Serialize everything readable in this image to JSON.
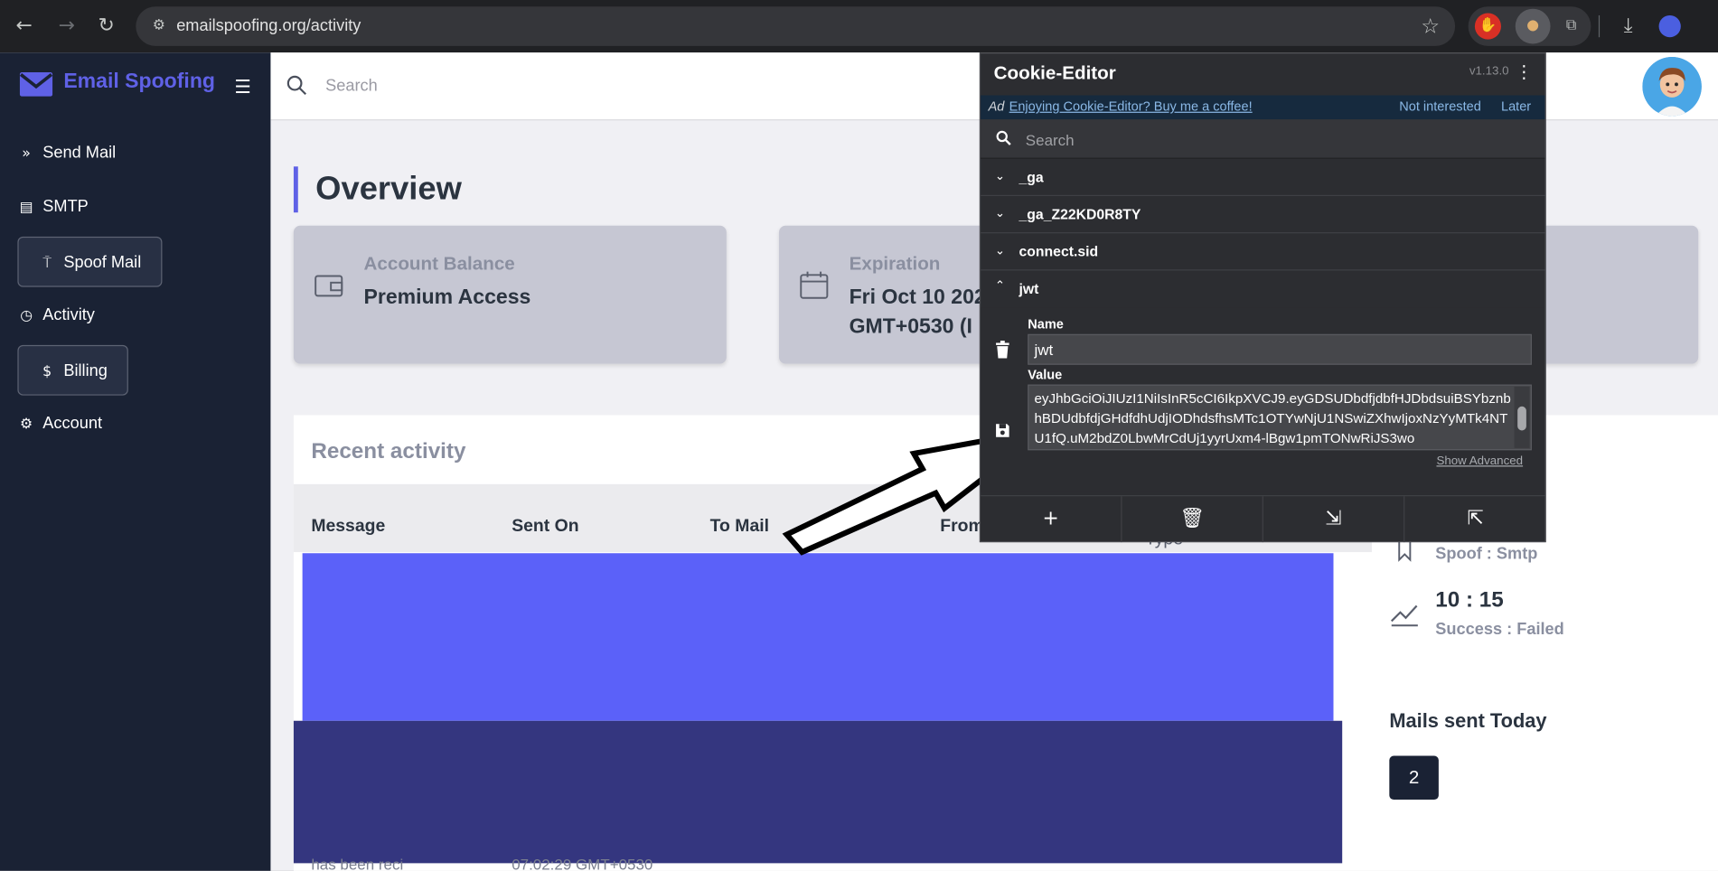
{
  "browser": {
    "url": "emailspoofing.org/activity",
    "colors": {
      "bar": "#202124",
      "omnibox": "#35363a"
    }
  },
  "app": {
    "brand": "Email Spoofing",
    "accent": "#5f61e6",
    "sidebar": {
      "items": [
        {
          "label": "Send Mail",
          "icon": "send-icon",
          "boxed": false
        },
        {
          "label": "SMTP",
          "icon": "server-icon",
          "boxed": false
        },
        {
          "label": "Spoof Mail",
          "icon": "paint-roller-icon",
          "boxed": true
        },
        {
          "label": "Activity",
          "icon": "clock-icon",
          "boxed": false
        },
        {
          "label": "Billing",
          "icon": "dollar-icon",
          "boxed": true
        },
        {
          "label": "Account",
          "icon": "gear-icon",
          "boxed": false
        }
      ]
    },
    "topbar": {
      "search_placeholder": "Search"
    },
    "page_title": "Overview",
    "cards": [
      {
        "label": "Account Balance",
        "value_line1": "Premium Access",
        "value_line2": "",
        "icon": "wallet-icon"
      },
      {
        "label": "Expiration",
        "value_line1": "Fri Oct 10 202",
        "value_line2": "GMT+0530 (I",
        "icon": "calendar-icon"
      }
    ],
    "recent_activity": {
      "title": "Recent activity",
      "columns": [
        "Message",
        "Sent On",
        "To Mail",
        "From",
        "Type"
      ],
      "partial_row": {
        "message": "has been reci",
        "sent_on": "07:02:29 GMT+0530"
      }
    },
    "stats": {
      "spoof_line": "Spoof : Smtp",
      "ratio": "10 : 15",
      "ratio_label": "Success : Failed"
    },
    "mails_today": {
      "title": "Mails sent Today",
      "count": "2"
    }
  },
  "cookie_editor": {
    "title": "Cookie-Editor",
    "version": "v1.13.0",
    "ad": {
      "tag": "Ad",
      "link": "Enjoying Cookie-Editor? Buy me a coffee!",
      "not_interested": "Not interested",
      "later": "Later"
    },
    "search_placeholder": "Search",
    "cookies": [
      {
        "name": "_ga",
        "expanded": false
      },
      {
        "name": "_ga_Z22KD0R8TY",
        "expanded": false
      },
      {
        "name": "connect.sid",
        "expanded": false
      },
      {
        "name": "jwt",
        "expanded": true
      }
    ],
    "selected": {
      "name_label": "Name",
      "name_value": "jwt",
      "value_label": "Value",
      "value": "eyJhbGciOiJIUzI1NiIsInR5cCI6IkpXVCJ9.eyGDSUDbdfjdbfHJDbdsuiBSYbznbhBDUdbfdjGHdfdhUdjIODhdsfhsMTc1OTYwNjU1NSwiZXhwIjoxNzYyMTk4NTU1fQ.uM2bdZ0LbwMrCdUj1yyrUxm4-lBgw1pmTONwRiJS3wo",
      "show_advanced": "Show Advanced"
    },
    "footer_buttons": [
      "add-icon",
      "delete-all-icon",
      "import-icon",
      "export-icon"
    ]
  }
}
